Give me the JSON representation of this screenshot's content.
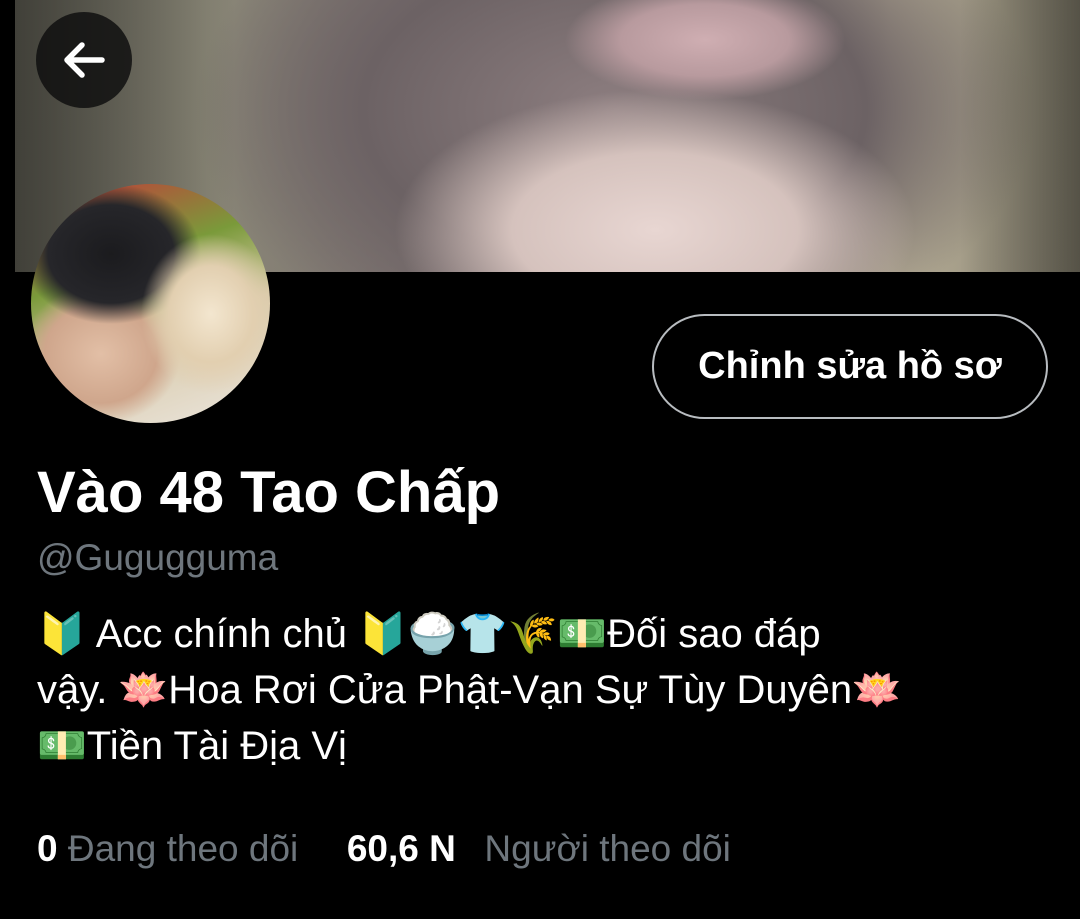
{
  "header": {
    "back_icon": "arrow-left-icon"
  },
  "profile": {
    "edit_button_label": "Chỉnh sửa hồ sơ",
    "display_name": "Vào 48 Tao Chấp",
    "handle": "@Gugugguma",
    "bio_line_1": "🔰 Acc chính chủ 🔰🍚👕🌾💵Đối sao đáp",
    "bio_line_2": "vậy. 🪷Hoa Rơi Cửa Phật-Vạn Sự Tùy Duyên🪷",
    "bio_line_3": "💵Tiền Tài Địa Vị"
  },
  "stats": {
    "following_count": "0",
    "following_label": "Đang theo dõi",
    "followers_count": "60,6 N",
    "followers_label": "Người theo dõi"
  },
  "colors": {
    "background": "#000000",
    "secondary_text": "#6e767d",
    "button_border": "#b8bcc0"
  }
}
